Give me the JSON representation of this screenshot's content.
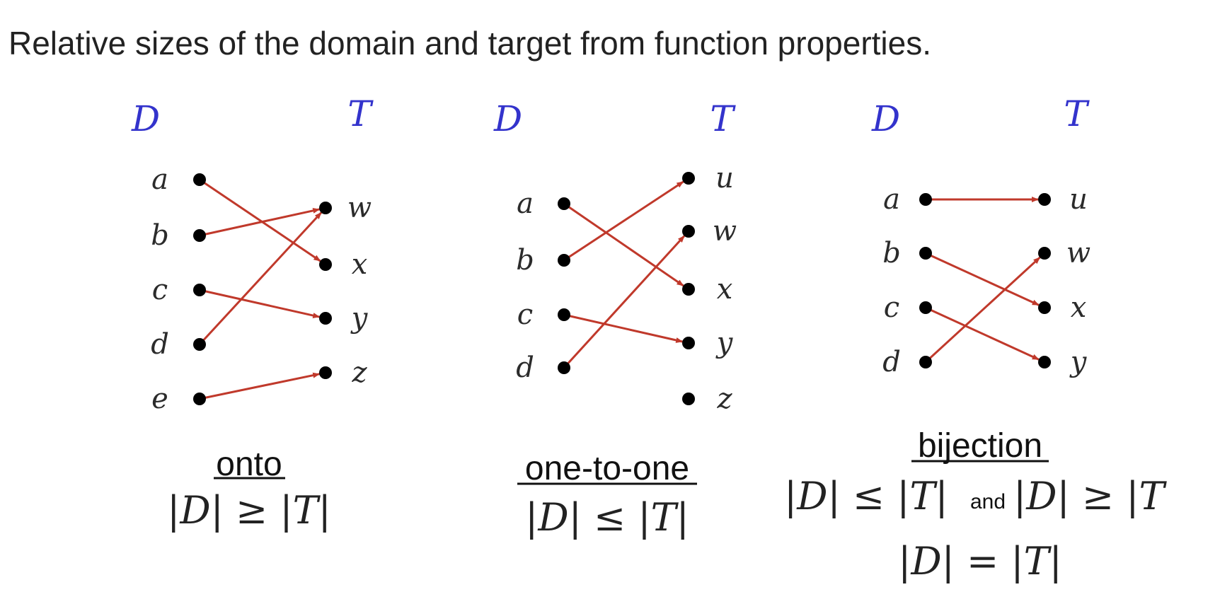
{
  "heading": "Relative sizes of the domain and target from function properties.",
  "colors": {
    "header": "#3333cc",
    "arrow": "#c0392b",
    "dot": "#000000"
  },
  "diagrams": [
    {
      "id": "onto",
      "domain_label": "D",
      "target_label": "T",
      "domain": [
        "a",
        "b",
        "c",
        "d",
        "e"
      ],
      "target": [
        "w",
        "x",
        "y",
        "z"
      ],
      "mapping": [
        [
          "a",
          "x"
        ],
        [
          "b",
          "w"
        ],
        [
          "c",
          "y"
        ],
        [
          "d",
          "w"
        ],
        [
          "e",
          "z"
        ]
      ],
      "title": "onto",
      "relation": "|D| ≥ |T|"
    },
    {
      "id": "one-to-one",
      "domain_label": "D",
      "target_label": "T",
      "domain": [
        "a",
        "b",
        "c",
        "d"
      ],
      "target": [
        "u",
        "w",
        "x",
        "y",
        "z"
      ],
      "mapping": [
        [
          "a",
          "x"
        ],
        [
          "b",
          "u"
        ],
        [
          "c",
          "y"
        ],
        [
          "d",
          "w"
        ]
      ],
      "title": "one-to-one",
      "relation": "|D| ≤ |T|"
    },
    {
      "id": "bijection",
      "domain_label": "D",
      "target_label": "T",
      "domain": [
        "a",
        "b",
        "c",
        "d"
      ],
      "target": [
        "u",
        "w",
        "x",
        "y"
      ],
      "mapping": [
        [
          "a",
          "u"
        ],
        [
          "b",
          "x"
        ],
        [
          "c",
          "y"
        ],
        [
          "d",
          "w"
        ]
      ],
      "title": "bijection",
      "relation_left": "|D| ≤ |T|",
      "relation_joiner": "and",
      "relation_right": "|D| ≥ |T",
      "relation_equal": "|D| = |T|"
    }
  ]
}
